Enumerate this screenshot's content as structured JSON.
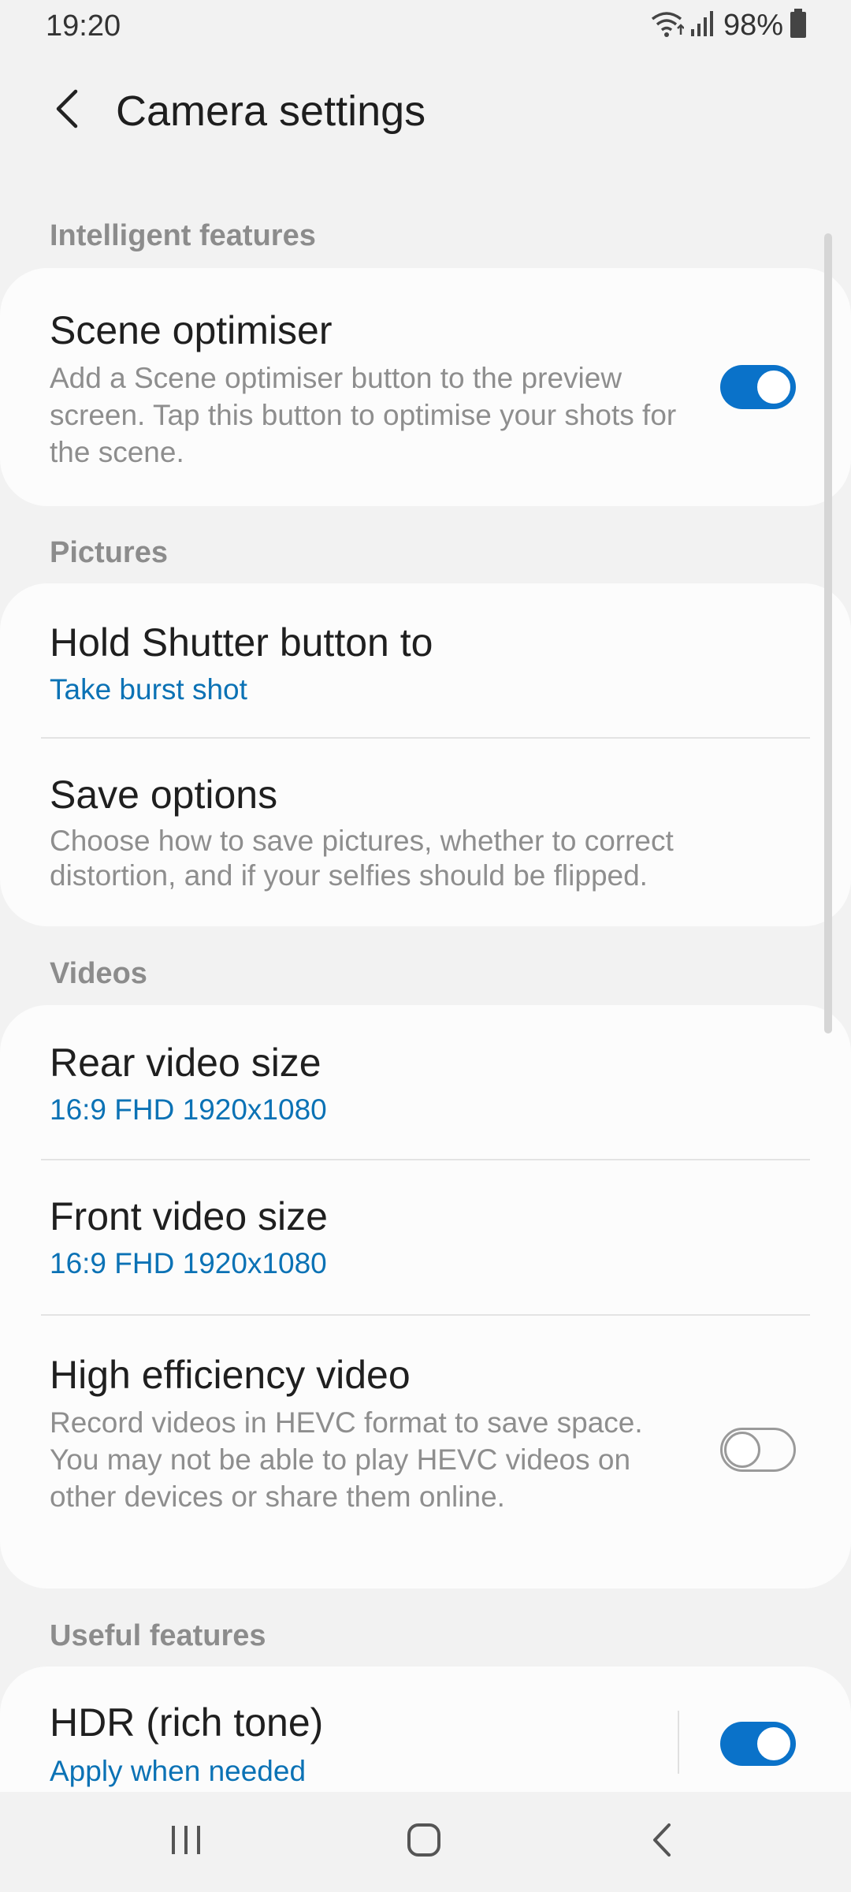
{
  "status_bar": {
    "time": "19:20",
    "battery": "98%",
    "icons": [
      "wifi-icon",
      "signal-icon",
      "battery-icon"
    ]
  },
  "header": {
    "title": "Camera settings",
    "back_icon": "chevron-left-icon"
  },
  "sections": {
    "intelligent": {
      "label": "Intelligent features",
      "scene_optimiser": {
        "title": "Scene optimiser",
        "description": "Add a Scene optimiser button to the preview screen. Tap this button to optimise your shots for the scene.",
        "enabled": true
      }
    },
    "pictures": {
      "label": "Pictures",
      "hold_shutter": {
        "title": "Hold Shutter button to",
        "value": "Take burst shot"
      },
      "save_options": {
        "title": "Save options",
        "description": "Choose how to save pictures, whether to correct distortion, and if your selfies should be flipped."
      }
    },
    "videos": {
      "label": "Videos",
      "rear_video_size": {
        "title": "Rear video size",
        "value": "16:9 FHD 1920x1080"
      },
      "front_video_size": {
        "title": "Front video size",
        "value": "16:9 FHD 1920x1080"
      },
      "high_efficiency": {
        "title": "High efficiency video",
        "description": "Record videos in HEVC format to save space. You may not be able to play HEVC videos on other devices or share them online.",
        "enabled": false
      }
    },
    "useful": {
      "label": "Useful features",
      "hdr": {
        "title": "HDR (rich tone)",
        "value": "Apply when needed",
        "enabled": true
      }
    }
  },
  "nav_bar": {
    "icons": [
      "recent-apps-icon",
      "home-icon",
      "back-icon"
    ]
  },
  "colors": {
    "accent": "#0a72c9",
    "value_text": "#0b72b5",
    "background": "#f2f2f2",
    "card": "#fcfcfc"
  }
}
